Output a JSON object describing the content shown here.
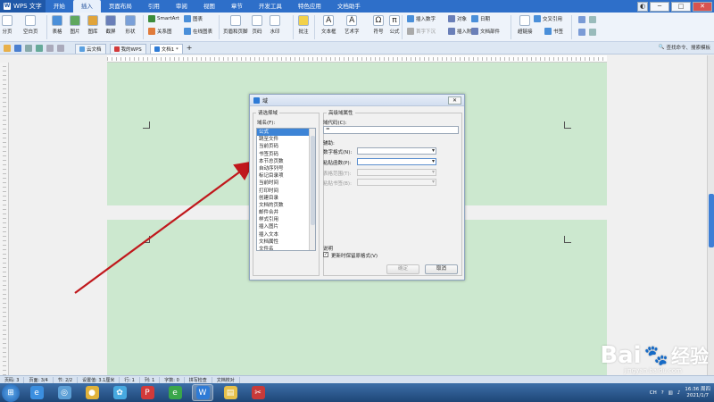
{
  "app": {
    "name": "WPS 文字",
    "logo": "W"
  },
  "menu": {
    "tabs": [
      "开始",
      "插入",
      "页面布局",
      "引用",
      "审阅",
      "视图",
      "章节",
      "开发工具",
      "特色应用",
      "文档助手"
    ],
    "active": "插入"
  },
  "ribbon": {
    "big": [
      {
        "id": "page-break",
        "label": "分页",
        "icon": "page-icon",
        "color": "#ffffff"
      },
      {
        "id": "blank-page",
        "label": "空白页",
        "icon": "blank-page-icon",
        "color": "#ffffff"
      },
      {
        "id": "table",
        "label": "表格",
        "icon": "table-icon",
        "color": "#4a8fd9"
      },
      {
        "id": "picture",
        "label": "图片",
        "icon": "picture-icon",
        "color": "#5fa85f"
      },
      {
        "id": "gallery",
        "label": "图库",
        "icon": "gallery-icon",
        "color": "#e0a43b"
      },
      {
        "id": "screenshot",
        "label": "截屏",
        "icon": "screenshot-icon",
        "color": "#6a7fb8"
      },
      {
        "id": "shapes",
        "label": "形状",
        "icon": "shapes-icon",
        "color": "#7aa0d8"
      },
      {
        "id": "header-footer",
        "label": "页眉和页脚",
        "icon": "header-footer-icon",
        "color": "#ffffff"
      },
      {
        "id": "page-number",
        "label": "页码",
        "icon": "page-number-icon",
        "color": "#ffffff"
      },
      {
        "id": "watermark",
        "label": "水印",
        "icon": "watermark-icon",
        "color": "#ffffff"
      },
      {
        "id": "comment",
        "label": "批注",
        "icon": "comment-icon",
        "color": "#f2d14a"
      },
      {
        "id": "textbox",
        "label": "文本框",
        "icon": "textbox-icon",
        "color": "#ffffff"
      },
      {
        "id": "wordart",
        "label": "艺术字",
        "icon": "wordart-icon",
        "color": "#ffffff"
      },
      {
        "id": "symbol",
        "label": "符号",
        "icon": "omega-icon",
        "color": "#ffffff"
      },
      {
        "id": "formula",
        "label": "公式",
        "icon": "pi-icon",
        "color": "#ffffff"
      },
      {
        "id": "hyperlink",
        "label": "超链接",
        "icon": "hyperlink-icon",
        "color": "#ffffff"
      }
    ],
    "small": [
      {
        "id": "smartart",
        "label": "SmartArt",
        "icon": "smartart-icon",
        "color": "#3c8c3c"
      },
      {
        "id": "chart",
        "label": "图表",
        "icon": "chart-icon",
        "color": "#4a8fd9"
      },
      {
        "id": "relation",
        "label": "关系图",
        "icon": "relation-icon",
        "color": "#e07b3b"
      },
      {
        "id": "online-chart",
        "label": "在线图表",
        "icon": "online-chart-icon",
        "color": "#4a8fd9"
      },
      {
        "id": "insert-number",
        "label": "插入数字",
        "icon": "number-icon",
        "color": "#4a8fd9"
      },
      {
        "id": "object",
        "label": "对象",
        "icon": "object-icon",
        "color": "#6a7fb8"
      },
      {
        "id": "date",
        "label": "日期",
        "icon": "date-icon",
        "color": "#4a8fd9"
      },
      {
        "id": "first-sink",
        "label": "首字下沉",
        "icon": "drop-cap-icon",
        "color": "#aaaaaa"
      },
      {
        "id": "attachment",
        "label": "插入附件",
        "icon": "attachment-icon",
        "color": "#6a7fb8"
      },
      {
        "id": "doc-parts",
        "label": "文档部件",
        "icon": "doc-parts-icon",
        "color": "#6a7fb8"
      },
      {
        "id": "cross-ref",
        "label": "交叉引用",
        "icon": "cross-ref-icon",
        "color": "#4a8fd9"
      },
      {
        "id": "bookmark",
        "label": "书签",
        "icon": "bookmark-icon",
        "color": "#4a8fd9"
      }
    ]
  },
  "quickbar": {
    "tabs": [
      {
        "label": "云文档",
        "icon": "cloud-icon"
      },
      {
        "label": "我的WPS",
        "icon": "wps-home-icon"
      },
      {
        "label": "文档1 *",
        "icon": "doc-icon"
      }
    ],
    "add": "+",
    "search": "查找命令、搜索模板"
  },
  "dialog": {
    "title": "域",
    "close": "✕",
    "left_group_title": "请选择域",
    "field_name_label": "域名(F):",
    "fields": [
      "公式",
      "跳至文件",
      "当前页码",
      "书签页码",
      "本节总页数",
      "自动序列号",
      "标记目录项",
      "当前时间",
      "打印时间",
      "创建目录",
      "文档的页数",
      "邮件合并",
      "样式引用",
      "插入图片",
      "插入文本",
      "文档属性",
      "文件名",
      "其他"
    ],
    "selected_field": "公式",
    "right_group_title": "高级域属性",
    "code_label": "域代码(C):",
    "code_value": "=",
    "assist_label": "辅助:",
    "number_format_label": "数字格式(N):",
    "paste_func_label": "粘贴函数(P):",
    "table_range_label": "表格范围(T):",
    "paste_bookmark_label": "粘贴书签(B):",
    "note_label": "说明",
    "keep_format_label": "更新时保留原格式(V)",
    "keep_format_checked": true,
    "ok": "确定",
    "cancel": "取消"
  },
  "status": {
    "items": [
      "页码: 3",
      "页面: 3/4",
      "节: 2/2",
      "设置值: 3.1厘米",
      "行: 1",
      "列: 1",
      "字数: 0",
      "拼写检查",
      "文档校对"
    ]
  },
  "taskbar": {
    "apps": [
      {
        "name": "ie-icon",
        "glyph": "e",
        "color": "#3b8fe0"
      },
      {
        "name": "search-icon",
        "glyph": "◎",
        "color": "#5c9fd6"
      },
      {
        "name": "chrome-icon",
        "glyph": "●",
        "color": "#e0b23b"
      },
      {
        "name": "qq-browser-icon",
        "glyph": "✿",
        "color": "#47a9e0"
      },
      {
        "name": "wps-pdf-icon",
        "glyph": "P",
        "color": "#d23a3a"
      },
      {
        "name": "green-app-icon",
        "glyph": "e",
        "color": "#3aa64a"
      },
      {
        "name": "wps-writer-icon",
        "glyph": "W",
        "color": "#2e7bd6"
      },
      {
        "name": "folder-icon",
        "glyph": "▤",
        "color": "#e6c04a"
      },
      {
        "name": "snip-tool-icon",
        "glyph": "✂",
        "color": "#c73a3a"
      }
    ],
    "active": "wps-writer-icon",
    "time": "16:36 周四",
    "date": "2021/1/7",
    "tray_lang": "CH"
  },
  "watermark": {
    "text": "Bai",
    "cn": "经验",
    "url": "jingyan.baidu.com"
  },
  "colors": {
    "page_bg": "#cce8cf",
    "title_blue": "#2e6fc9",
    "arrow": "#c0181c"
  }
}
